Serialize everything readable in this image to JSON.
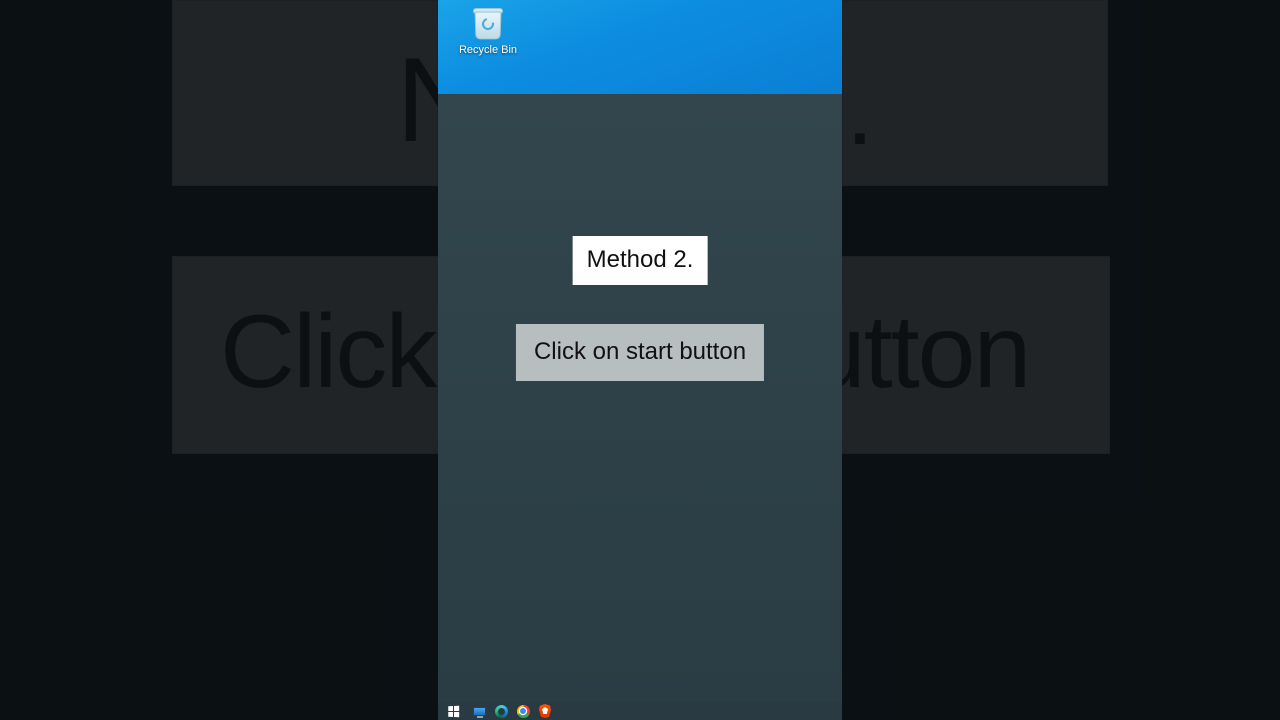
{
  "background": {
    "zoom_text_left": "Click",
    "zoom_text_right": "utton",
    "zoom_text_top_left_fragment": "N",
    "zoom_text_top_right_fragment": "."
  },
  "desktop": {
    "icons": {
      "recycle_bin_label": "Recycle Bin"
    }
  },
  "captions": {
    "primary": "Method 2.",
    "secondary": "Click on start button"
  },
  "taskbar": {
    "items": [
      {
        "name": "start",
        "label": "Start"
      },
      {
        "name": "file-explorer",
        "label": "File Explorer"
      },
      {
        "name": "edge",
        "label": "Microsoft Edge"
      },
      {
        "name": "chrome",
        "label": "Google Chrome"
      },
      {
        "name": "brave",
        "label": "Brave"
      }
    ]
  },
  "colors": {
    "wallpaper_blue": "#0d8de0",
    "dim_overlay": "#314650",
    "caption_white": "#ffffff",
    "caption_grey": "#b7bec0"
  }
}
